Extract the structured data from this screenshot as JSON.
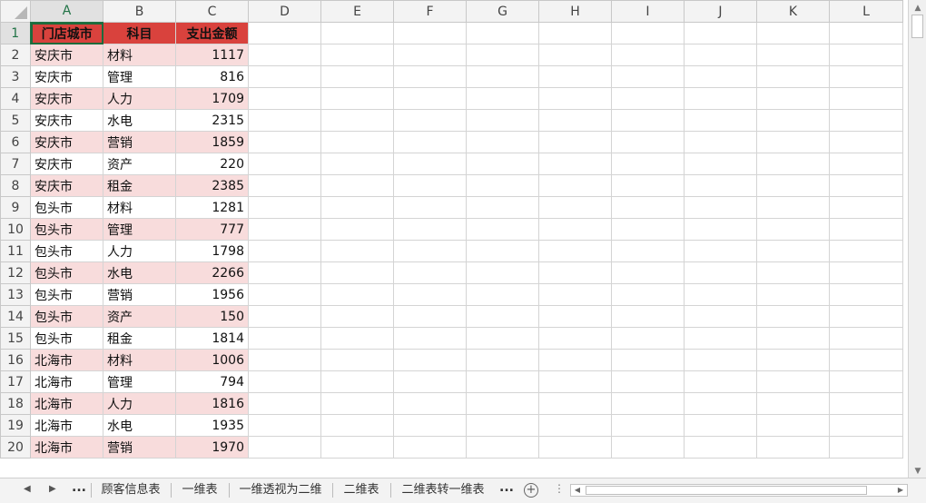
{
  "columns": [
    "A",
    "B",
    "C",
    "D",
    "E",
    "F",
    "G",
    "H",
    "I",
    "J",
    "K",
    "L"
  ],
  "header_row": {
    "row": "1",
    "city": "门店城市",
    "subject": "科目",
    "amount": "支出金额"
  },
  "rows": [
    {
      "row": "2",
      "city": "安庆市",
      "subject": "材料",
      "amount": "1117"
    },
    {
      "row": "3",
      "city": "安庆市",
      "subject": "管理",
      "amount": "816"
    },
    {
      "row": "4",
      "city": "安庆市",
      "subject": "人力",
      "amount": "1709"
    },
    {
      "row": "5",
      "city": "安庆市",
      "subject": "水电",
      "amount": "2315"
    },
    {
      "row": "6",
      "city": "安庆市",
      "subject": "营销",
      "amount": "1859"
    },
    {
      "row": "7",
      "city": "安庆市",
      "subject": "资产",
      "amount": "220"
    },
    {
      "row": "8",
      "city": "安庆市",
      "subject": "租金",
      "amount": "2385"
    },
    {
      "row": "9",
      "city": "包头市",
      "subject": "材料",
      "amount": "1281"
    },
    {
      "row": "10",
      "city": "包头市",
      "subject": "管理",
      "amount": "777"
    },
    {
      "row": "11",
      "city": "包头市",
      "subject": "人力",
      "amount": "1798"
    },
    {
      "row": "12",
      "city": "包头市",
      "subject": "水电",
      "amount": "2266"
    },
    {
      "row": "13",
      "city": "包头市",
      "subject": "营销",
      "amount": "1956"
    },
    {
      "row": "14",
      "city": "包头市",
      "subject": "资产",
      "amount": "150"
    },
    {
      "row": "15",
      "city": "包头市",
      "subject": "租金",
      "amount": "1814"
    },
    {
      "row": "16",
      "city": "北海市",
      "subject": "材料",
      "amount": "1006"
    },
    {
      "row": "17",
      "city": "北海市",
      "subject": "管理",
      "amount": "794"
    },
    {
      "row": "18",
      "city": "北海市",
      "subject": "人力",
      "amount": "1816"
    },
    {
      "row": "19",
      "city": "北海市",
      "subject": "水电",
      "amount": "1935"
    },
    {
      "row": "20",
      "city": "北海市",
      "subject": "营销",
      "amount": "1970"
    }
  ],
  "tabs": {
    "ellipsis_left": "...",
    "items": [
      "顾客信息表",
      "一维表",
      "一维透视为二维",
      "二维表",
      "二维表转一维表"
    ],
    "ellipsis_right": "..."
  },
  "colors": {
    "header_fill": "#d9423d",
    "band_fill": "#f8dcdc",
    "selection_green": "#217346"
  }
}
